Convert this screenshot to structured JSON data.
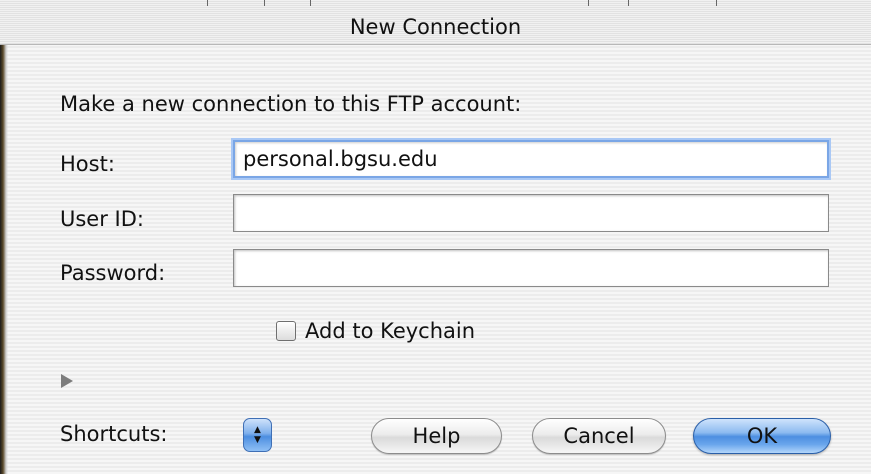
{
  "dialog": {
    "title": "New Connection",
    "prompt": "Make a new connection to this FTP account:"
  },
  "fields": {
    "host_label": "Host:",
    "host_value": "personal.bgsu.edu",
    "user_label": "User ID:",
    "user_value": "",
    "password_label": "Password:",
    "password_value": ""
  },
  "keychain": {
    "label": "Add to Keychain",
    "checked": false
  },
  "shortcuts": {
    "label": "Shortcuts:"
  },
  "buttons": {
    "help": "Help",
    "cancel": "Cancel",
    "ok": "OK"
  },
  "icons": {
    "disclosure": "disclosure-triangle-icon",
    "popup": "popup-arrows-icon"
  },
  "colors": {
    "default_button": "#4d8fe1",
    "focus_ring": "#7aa6e6"
  }
}
